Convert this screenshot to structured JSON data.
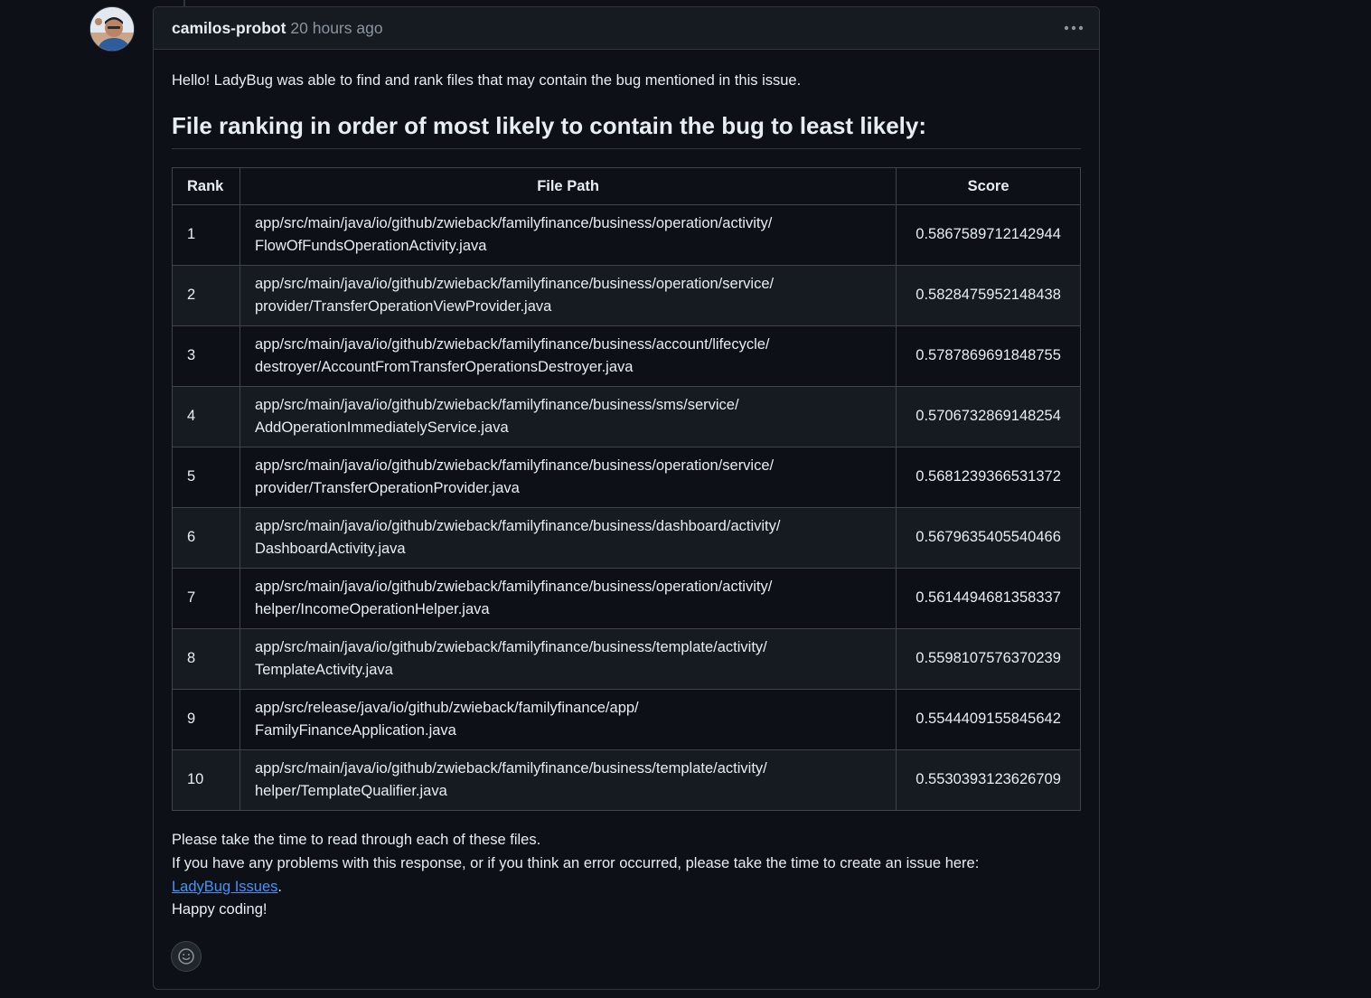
{
  "comment": {
    "author": "camilos-probot",
    "timestamp": "20 hours ago",
    "intro": "Hello! LadyBug was able to find and rank files that may contain the bug mentioned in this issue.",
    "heading": "File ranking in order of most likely to contain the bug to least likely:",
    "table": {
      "headers": [
        "Rank",
        "File Path",
        "Score"
      ],
      "rows": [
        {
          "rank": "1",
          "path_line1": "app/src/main/java/io/github/zwieback/familyfinance/business/operation/activity/",
          "path_line2": "FlowOfFundsOperationActivity.java",
          "score": "0.5867589712142944"
        },
        {
          "rank": "2",
          "path_line1": "app/src/main/java/io/github/zwieback/familyfinance/business/operation/service/",
          "path_line2": "provider/TransferOperationViewProvider.java",
          "score": "0.5828475952148438"
        },
        {
          "rank": "3",
          "path_line1": "app/src/main/java/io/github/zwieback/familyfinance/business/account/lifecycle/",
          "path_line2": "destroyer/AccountFromTransferOperationsDestroyer.java",
          "score": "0.5787869691848755"
        },
        {
          "rank": "4",
          "path_line1": "app/src/main/java/io/github/zwieback/familyfinance/business/sms/service/",
          "path_line2": "AddOperationImmediatelyService.java",
          "score": "0.5706732869148254"
        },
        {
          "rank": "5",
          "path_line1": "app/src/main/java/io/github/zwieback/familyfinance/business/operation/service/",
          "path_line2": "provider/TransferOperationProvider.java",
          "score": "0.5681239366531372"
        },
        {
          "rank": "6",
          "path_line1": "app/src/main/java/io/github/zwieback/familyfinance/business/dashboard/activity/",
          "path_line2": "DashboardActivity.java",
          "score": "0.5679635405540466"
        },
        {
          "rank": "7",
          "path_line1": "app/src/main/java/io/github/zwieback/familyfinance/business/operation/activity/",
          "path_line2": "helper/IncomeOperationHelper.java",
          "score": "0.5614494681358337"
        },
        {
          "rank": "8",
          "path_line1": "app/src/main/java/io/github/zwieback/familyfinance/business/template/activity/",
          "path_line2": "TemplateActivity.java",
          "score": "0.5598107576370239"
        },
        {
          "rank": "9",
          "path_line1": "app/src/release/java/io/github/zwieback/familyfinance/app/",
          "path_line2": "FamilyFinanceApplication.java",
          "score": "0.5544409155845642"
        },
        {
          "rank": "10",
          "path_line1": "app/src/main/java/io/github/zwieback/familyfinance/business/template/activity/",
          "path_line2": "helper/TemplateQualifier.java",
          "score": "0.5530393123626709"
        }
      ]
    },
    "outro": {
      "line1": "Please take the time to read through each of these files.",
      "line2": "If you have any problems with this response, or if you think an error occurred, please take the time to create an issue here:",
      "link_text": "LadyBug Issues",
      "link_suffix": ".",
      "line4": "Happy coding!"
    },
    "icons": {
      "menu": "kebab-horizontal-icon",
      "reaction": "smiley-icon",
      "avatar": "user-avatar"
    }
  }
}
